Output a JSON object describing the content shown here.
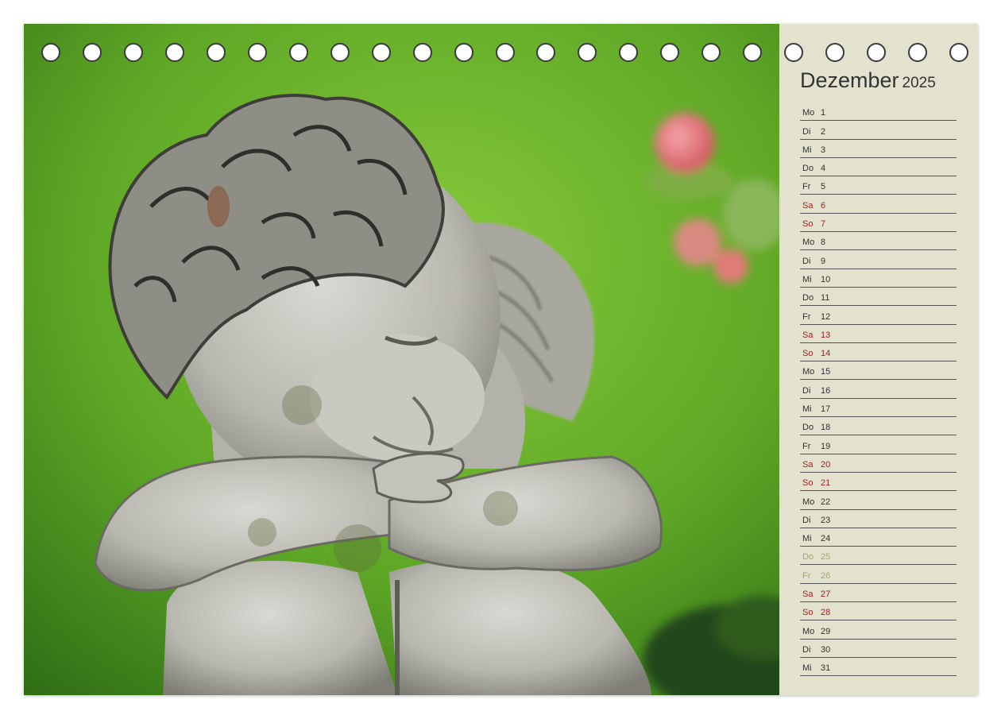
{
  "calendar": {
    "month": "Dezember",
    "year": "2025",
    "colors": {
      "weekday": "#333333",
      "weekend": "#9e1d1d",
      "holiday": "#a4a872",
      "panel": "#e2e2cf",
      "photo_background": "#6fb72c"
    },
    "binding_hole_count": 23,
    "days": [
      {
        "weekday": "Mo",
        "day": "1",
        "type": "weekday"
      },
      {
        "weekday": "Di",
        "day": "2",
        "type": "weekday"
      },
      {
        "weekday": "Mi",
        "day": "3",
        "type": "weekday"
      },
      {
        "weekday": "Do",
        "day": "4",
        "type": "weekday"
      },
      {
        "weekday": "Fr",
        "day": "5",
        "type": "weekday"
      },
      {
        "weekday": "Sa",
        "day": "6",
        "type": "weekend"
      },
      {
        "weekday": "So",
        "day": "7",
        "type": "weekend"
      },
      {
        "weekday": "Mo",
        "day": "8",
        "type": "weekday"
      },
      {
        "weekday": "Di",
        "day": "9",
        "type": "weekday"
      },
      {
        "weekday": "Mi",
        "day": "10",
        "type": "weekday"
      },
      {
        "weekday": "Do",
        "day": "11",
        "type": "weekday"
      },
      {
        "weekday": "Fr",
        "day": "12",
        "type": "weekday"
      },
      {
        "weekday": "Sa",
        "day": "13",
        "type": "weekend"
      },
      {
        "weekday": "So",
        "day": "14",
        "type": "weekend"
      },
      {
        "weekday": "Mo",
        "day": "15",
        "type": "weekday"
      },
      {
        "weekday": "Di",
        "day": "16",
        "type": "weekday"
      },
      {
        "weekday": "Mi",
        "day": "17",
        "type": "weekday"
      },
      {
        "weekday": "Do",
        "day": "18",
        "type": "weekday"
      },
      {
        "weekday": "Fr",
        "day": "19",
        "type": "weekday"
      },
      {
        "weekday": "Sa",
        "day": "20",
        "type": "weekend"
      },
      {
        "weekday": "So",
        "day": "21",
        "type": "weekend"
      },
      {
        "weekday": "Mo",
        "day": "22",
        "type": "weekday"
      },
      {
        "weekday": "Di",
        "day": "23",
        "type": "weekday"
      },
      {
        "weekday": "Mi",
        "day": "24",
        "type": "weekday"
      },
      {
        "weekday": "Do",
        "day": "25",
        "type": "holiday"
      },
      {
        "weekday": "Fr",
        "day": "26",
        "type": "holiday"
      },
      {
        "weekday": "Sa",
        "day": "27",
        "type": "weekend"
      },
      {
        "weekday": "So",
        "day": "28",
        "type": "weekend"
      },
      {
        "weekday": "Mo",
        "day": "29",
        "type": "weekday"
      },
      {
        "weekday": "Di",
        "day": "30",
        "type": "weekday"
      },
      {
        "weekday": "Mi",
        "day": "31",
        "type": "weekday"
      }
    ]
  }
}
